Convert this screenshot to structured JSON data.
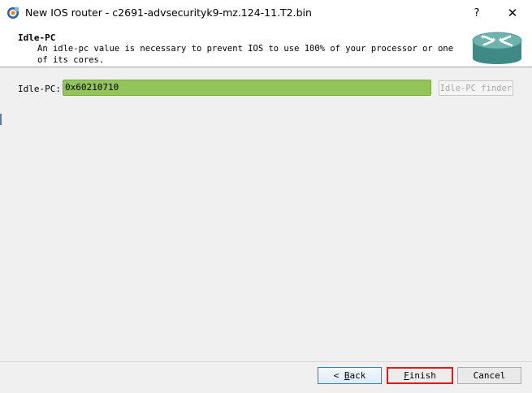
{
  "window": {
    "title": "New IOS router - c2691-advsecurityk9-mz.124-11.T2.bin",
    "help_glyph": "?",
    "close_glyph": "✕",
    "icons": {
      "app": "gns3-app-icon",
      "help": "help-icon",
      "close": "close-icon"
    }
  },
  "header": {
    "title": "Idle-PC",
    "description": "An idle-pc value is necessary to prevent IOS to use 100% of your processor or one of its cores.",
    "icon": "router-icon"
  },
  "form": {
    "idlepc_label": "Idle-PC:",
    "idlepc_value": "0x60210710",
    "finder_button": "Idle-PC finder",
    "input_color": "#92c45a"
  },
  "buttons": {
    "back_arrow": "<",
    "back_mnemonic": "B",
    "back_rest": "ack",
    "finish_mnemonic": "F",
    "finish_rest": "inish",
    "cancel": "Cancel",
    "highlight_color": "#e01a1a"
  }
}
